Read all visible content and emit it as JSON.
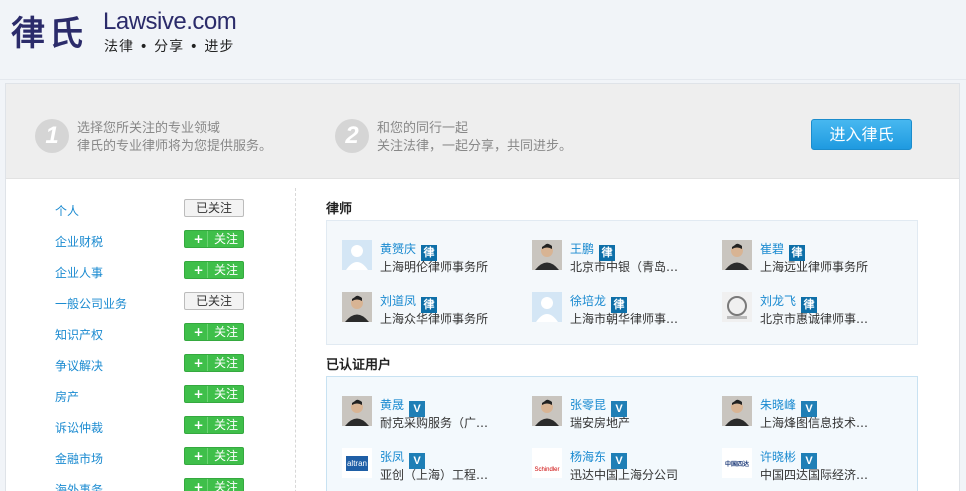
{
  "brand": {
    "logo_cn": "律氏",
    "logo_en": "Lawsive.com",
    "slogan": "法律 • 分享 • 进步"
  },
  "steps": [
    {
      "num": "1",
      "line1": "选择您所关注的专业领域",
      "line2": "律氏的专业律师将为您提供服务。"
    },
    {
      "num": "2",
      "line1": "和您的同行一起",
      "line2": "关注法律，一起分享，共同进步。"
    }
  ],
  "enter_button": "进入律氏",
  "categories": [
    {
      "name": "个人",
      "button": "已关注",
      "state": "followed"
    },
    {
      "name": "企业财税",
      "button": "关注",
      "state": "follow"
    },
    {
      "name": "企业人事",
      "button": "关注",
      "state": "follow"
    },
    {
      "name": "一般公司业务",
      "button": "已关注",
      "state": "followed"
    },
    {
      "name": "知识产权",
      "button": "关注",
      "state": "follow"
    },
    {
      "name": "争议解决",
      "button": "关注",
      "state": "follow"
    },
    {
      "name": "房产",
      "button": "关注",
      "state": "follow"
    },
    {
      "name": "诉讼仲裁",
      "button": "关注",
      "state": "follow"
    },
    {
      "name": "金融市场",
      "button": "关注",
      "state": "follow"
    },
    {
      "name": "海外事务",
      "button": "关注",
      "state": "follow"
    }
  ],
  "plus_glyph": "+",
  "lawyers_section": {
    "title": "律师",
    "badge": "律",
    "people": [
      {
        "name": "黄赟庆",
        "org": "上海明伦律师事务所",
        "avatar": "default-avatar"
      },
      {
        "name": "王鹏",
        "org": "北京市中银（青岛…",
        "avatar": "photo-avatar"
      },
      {
        "name": "崔碧",
        "org": "上海远业律师事务所",
        "avatar": "photo-avatar"
      },
      {
        "name": "刘道凤",
        "org": "上海众华律师事务所",
        "avatar": "photo-avatar"
      },
      {
        "name": "徐培龙",
        "org": "上海市朝华律师事…",
        "avatar": "default-avatar"
      },
      {
        "name": "刘龙飞",
        "org": "北京市惠诚律师事…",
        "avatar": "logo-avatar"
      }
    ]
  },
  "users_section": {
    "title": "已认证用户",
    "badge": "V",
    "people": [
      {
        "name": "黄晟",
        "org": "耐克采购服务（广…",
        "avatar": "photo-avatar"
      },
      {
        "name": "张零昆",
        "org": "瑞安房地产",
        "avatar": "photo-avatar"
      },
      {
        "name": "朱晓峰",
        "org": "上海烽图信息技术…",
        "avatar": "photo-avatar"
      },
      {
        "name": "张凤",
        "org": "亚创（上海）工程…",
        "avatar": "altran-logo",
        "logo_text": "altran"
      },
      {
        "name": "杨海东",
        "org": "迅达中国上海分公司",
        "avatar": "schindler-logo",
        "logo_text": "Schindler"
      },
      {
        "name": "许晓彬",
        "org": "中国四达国际经济…",
        "avatar": "sida-logo",
        "logo_text": "中国四达"
      }
    ]
  },
  "colors": {
    "brand": "#2b2b6a",
    "link": "#1a8ad0",
    "follow_green": "#3fbf4a",
    "enter_blue": "#2aa4e6"
  }
}
